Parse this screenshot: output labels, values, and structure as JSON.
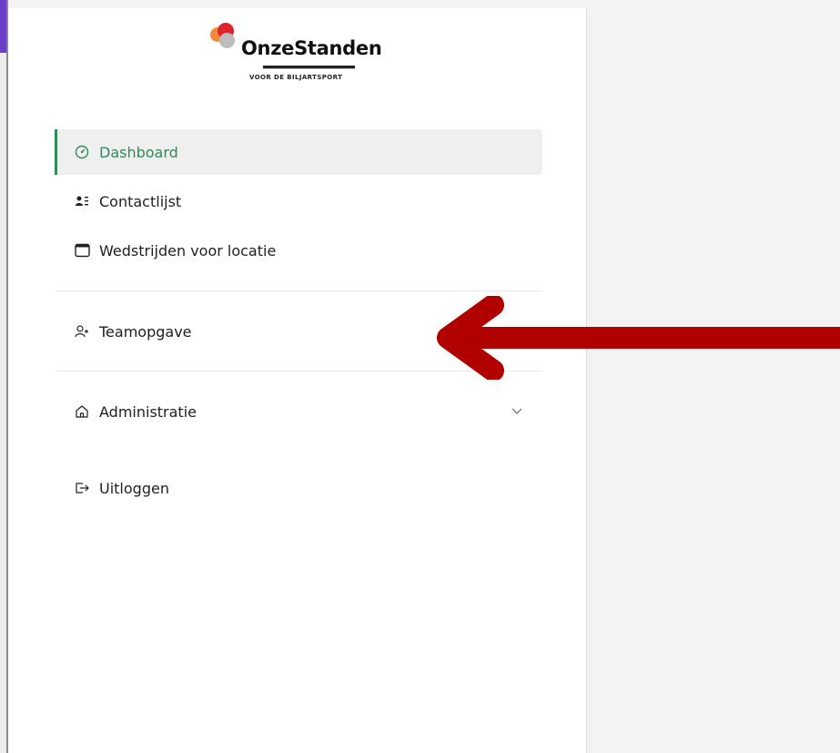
{
  "brand": {
    "name": "OnzeStanden",
    "tagline": "VOOR DE BILJARTSPORT"
  },
  "nav": {
    "items": [
      {
        "label": "Dashboard",
        "icon": "gauge-icon",
        "active": true
      },
      {
        "label": "Contactlijst",
        "icon": "contact-list-icon",
        "active": false
      },
      {
        "label": "Wedstrijden voor locatie",
        "icon": "calendar-icon",
        "active": false
      },
      {
        "label": "Teamopgave",
        "icon": "user-plus-icon",
        "active": false
      },
      {
        "label": "Administratie",
        "icon": "home-icon",
        "active": false,
        "expandable": true
      },
      {
        "label": "Uitloggen",
        "icon": "logout-icon",
        "active": false
      }
    ]
  },
  "colors": {
    "accent": "#2e8b57",
    "annotation_arrow": "#b00000",
    "active_bg": "#efefef"
  }
}
